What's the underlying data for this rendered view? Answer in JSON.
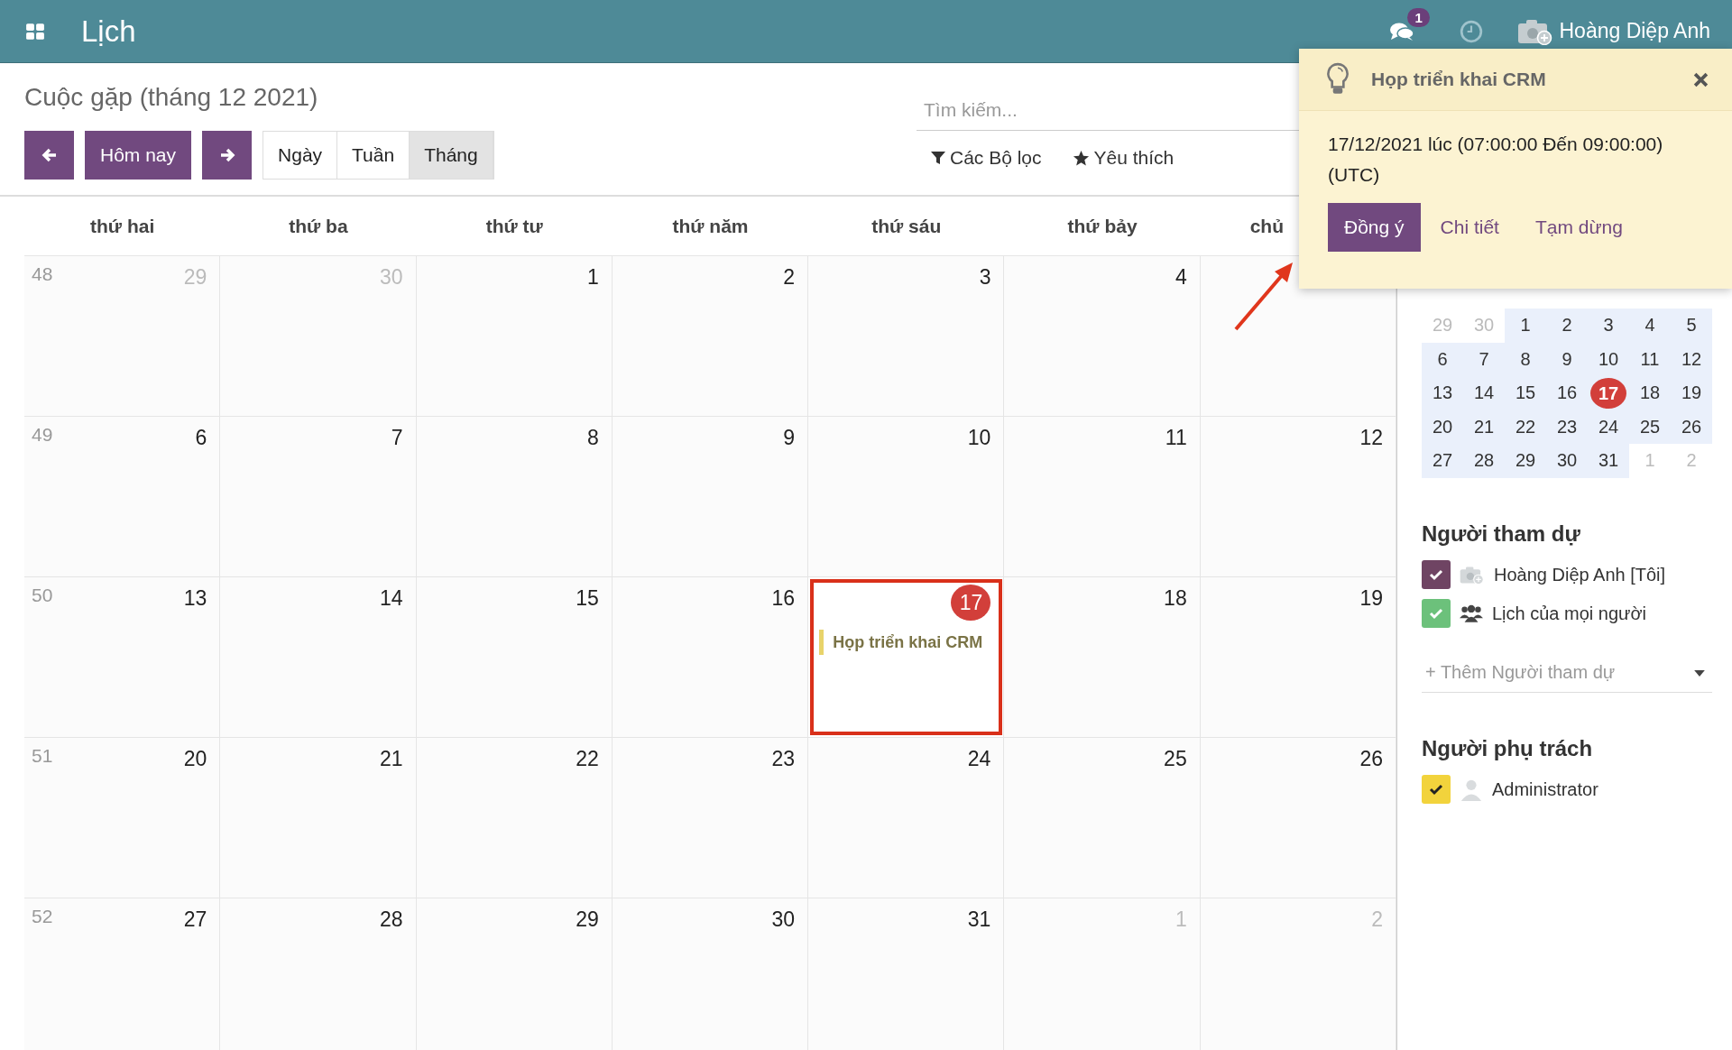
{
  "app_bar": {
    "title": "Lịch",
    "messages_badge": "1",
    "user": "Hoàng Diệp Anh"
  },
  "control_panel": {
    "title": "Cuộc gặp (tháng 12 2021)",
    "today_button": "Hôm nay",
    "views": [
      {
        "label": "Ngày",
        "selected": false
      },
      {
        "label": "Tuần",
        "selected": false
      },
      {
        "label": "Tháng",
        "selected": true
      }
    ],
    "search": {
      "placeholder": "Tìm kiếm..."
    },
    "filters": [
      {
        "kind": "filter",
        "label": "Các Bộ lọc"
      },
      {
        "kind": "favorite",
        "label": "Yêu thích"
      }
    ]
  },
  "calendar": {
    "weekdays": [
      "thứ hai",
      "thứ ba",
      "thứ tư",
      "thứ năm",
      "thứ sáu",
      "thứ bảy",
      "chủ"
    ],
    "weeks": [
      {
        "week": "48",
        "days": [
          {
            "label": "29",
            "other_month": true,
            "today": false
          },
          {
            "label": "30",
            "other_month": true,
            "today": false
          },
          {
            "label": "1",
            "other_month": false,
            "today": false
          },
          {
            "label": "2",
            "other_month": false,
            "today": false
          },
          {
            "label": "3",
            "other_month": false,
            "today": false
          },
          {
            "label": "4",
            "other_month": false,
            "today": false
          }
        ]
      },
      {
        "week": "49",
        "days": [
          {
            "label": "6",
            "other_month": false,
            "today": false
          },
          {
            "label": "7",
            "other_month": false,
            "today": false
          },
          {
            "label": "8",
            "other_month": false,
            "today": false
          },
          {
            "label": "9",
            "other_month": false,
            "today": false
          },
          {
            "label": "10",
            "other_month": false,
            "today": false
          },
          {
            "label": "11",
            "other_month": false,
            "today": false
          },
          {
            "label": "12",
            "other_month": false,
            "today": false
          }
        ]
      },
      {
        "week": "50",
        "days": [
          {
            "label": "13",
            "other_month": false,
            "today": false
          },
          {
            "label": "14",
            "other_month": false,
            "today": false
          },
          {
            "label": "15",
            "other_month": false,
            "today": false
          },
          {
            "label": "16",
            "other_month": false,
            "today": false
          },
          {
            "label": "17",
            "other_month": false,
            "today": true,
            "highlighted": true,
            "events": [
              {
                "title": "Họp triển khai CRM",
                "color": "#e8d36a"
              }
            ]
          },
          {
            "label": "18",
            "other_month": false,
            "today": false
          },
          {
            "label": "19",
            "other_month": false,
            "today": false
          }
        ]
      },
      {
        "week": "51",
        "days": [
          {
            "label": "20",
            "other_month": false,
            "today": false
          },
          {
            "label": "21",
            "other_month": false,
            "today": false
          },
          {
            "label": "22",
            "other_month": false,
            "today": false
          },
          {
            "label": "23",
            "other_month": false,
            "today": false
          },
          {
            "label": "24",
            "other_month": false,
            "today": false
          },
          {
            "label": "25",
            "other_month": false,
            "today": false
          },
          {
            "label": "26",
            "other_month": false,
            "today": false
          }
        ]
      },
      {
        "week": "52",
        "days": [
          {
            "label": "27",
            "other_month": false,
            "today": false
          },
          {
            "label": "28",
            "other_month": false,
            "today": false
          },
          {
            "label": "29",
            "other_month": false,
            "today": false
          },
          {
            "label": "30",
            "other_month": false,
            "today": false
          },
          {
            "label": "31",
            "other_month": false,
            "today": false
          },
          {
            "label": "1",
            "other_month": true,
            "today": false
          },
          {
            "label": "2",
            "other_month": true,
            "today": false
          }
        ]
      }
    ]
  },
  "mini_calendar": {
    "weeks": [
      [
        {
          "label": "29",
          "other_month": true,
          "today": false
        },
        {
          "label": "30",
          "other_month": true,
          "today": false
        },
        {
          "label": "1",
          "other_month": false,
          "today": false
        },
        {
          "label": "2",
          "other_month": false,
          "today": false
        },
        {
          "label": "3",
          "other_month": false,
          "today": false
        },
        {
          "label": "4",
          "other_month": false,
          "today": false
        },
        {
          "label": "5",
          "other_month": false,
          "today": false
        }
      ],
      [
        {
          "label": "6",
          "other_month": false,
          "today": false
        },
        {
          "label": "7",
          "other_month": false,
          "today": false
        },
        {
          "label": "8",
          "other_month": false,
          "today": false
        },
        {
          "label": "9",
          "other_month": false,
          "today": false
        },
        {
          "label": "10",
          "other_month": false,
          "today": false
        },
        {
          "label": "11",
          "other_month": false,
          "today": false
        },
        {
          "label": "12",
          "other_month": false,
          "today": false
        }
      ],
      [
        {
          "label": "13",
          "other_month": false,
          "today": false
        },
        {
          "label": "14",
          "other_month": false,
          "today": false
        },
        {
          "label": "15",
          "other_month": false,
          "today": false
        },
        {
          "label": "16",
          "other_month": false,
          "today": false
        },
        {
          "label": "17",
          "other_month": false,
          "today": true
        },
        {
          "label": "18",
          "other_month": false,
          "today": false
        },
        {
          "label": "19",
          "other_month": false,
          "today": false
        }
      ],
      [
        {
          "label": "20",
          "other_month": false,
          "today": false
        },
        {
          "label": "21",
          "other_month": false,
          "today": false
        },
        {
          "label": "22",
          "other_month": false,
          "today": false
        },
        {
          "label": "23",
          "other_month": false,
          "today": false
        },
        {
          "label": "24",
          "other_month": false,
          "today": false
        },
        {
          "label": "25",
          "other_month": false,
          "today": false
        },
        {
          "label": "26",
          "other_month": false,
          "today": false
        }
      ],
      [
        {
          "label": "27",
          "other_month": false,
          "today": false
        },
        {
          "label": "28",
          "other_month": false,
          "today": false
        },
        {
          "label": "29",
          "other_month": false,
          "today": false
        },
        {
          "label": "30",
          "other_month": false,
          "today": false
        },
        {
          "label": "31",
          "other_month": false,
          "today": false
        },
        {
          "label": "1",
          "other_month": true,
          "today": false
        },
        {
          "label": "2",
          "other_month": true,
          "today": false
        }
      ]
    ]
  },
  "filter_sections": [
    {
      "title": "Người tham dự",
      "items": [
        {
          "kind": "camera",
          "label": "Hoàng Diệp Anh [Tôi]",
          "checked": true,
          "color": "#6f4463"
        },
        {
          "kind": "group",
          "label": "Lịch của mọi người",
          "checked": true,
          "color": "#6cc17b"
        }
      ],
      "add_field": {
        "placeholder": "+ Thêm Người tham dự"
      }
    },
    {
      "title": "Người phụ trách",
      "items": [
        {
          "kind": "person",
          "label": "Administrator",
          "checked": true,
          "color": "#f2d33c"
        }
      ]
    }
  ],
  "popover": {
    "title": "Họp triển khai CRM",
    "body": "17/12/2021 lúc (07:00:00 Đến 09:00:00) (UTC)",
    "buttons": [
      {
        "label": "Đồng ý",
        "primary": true
      },
      {
        "label": "Chi tiết",
        "primary": false
      },
      {
        "label": "Tạm dừng",
        "primary": false
      }
    ]
  }
}
